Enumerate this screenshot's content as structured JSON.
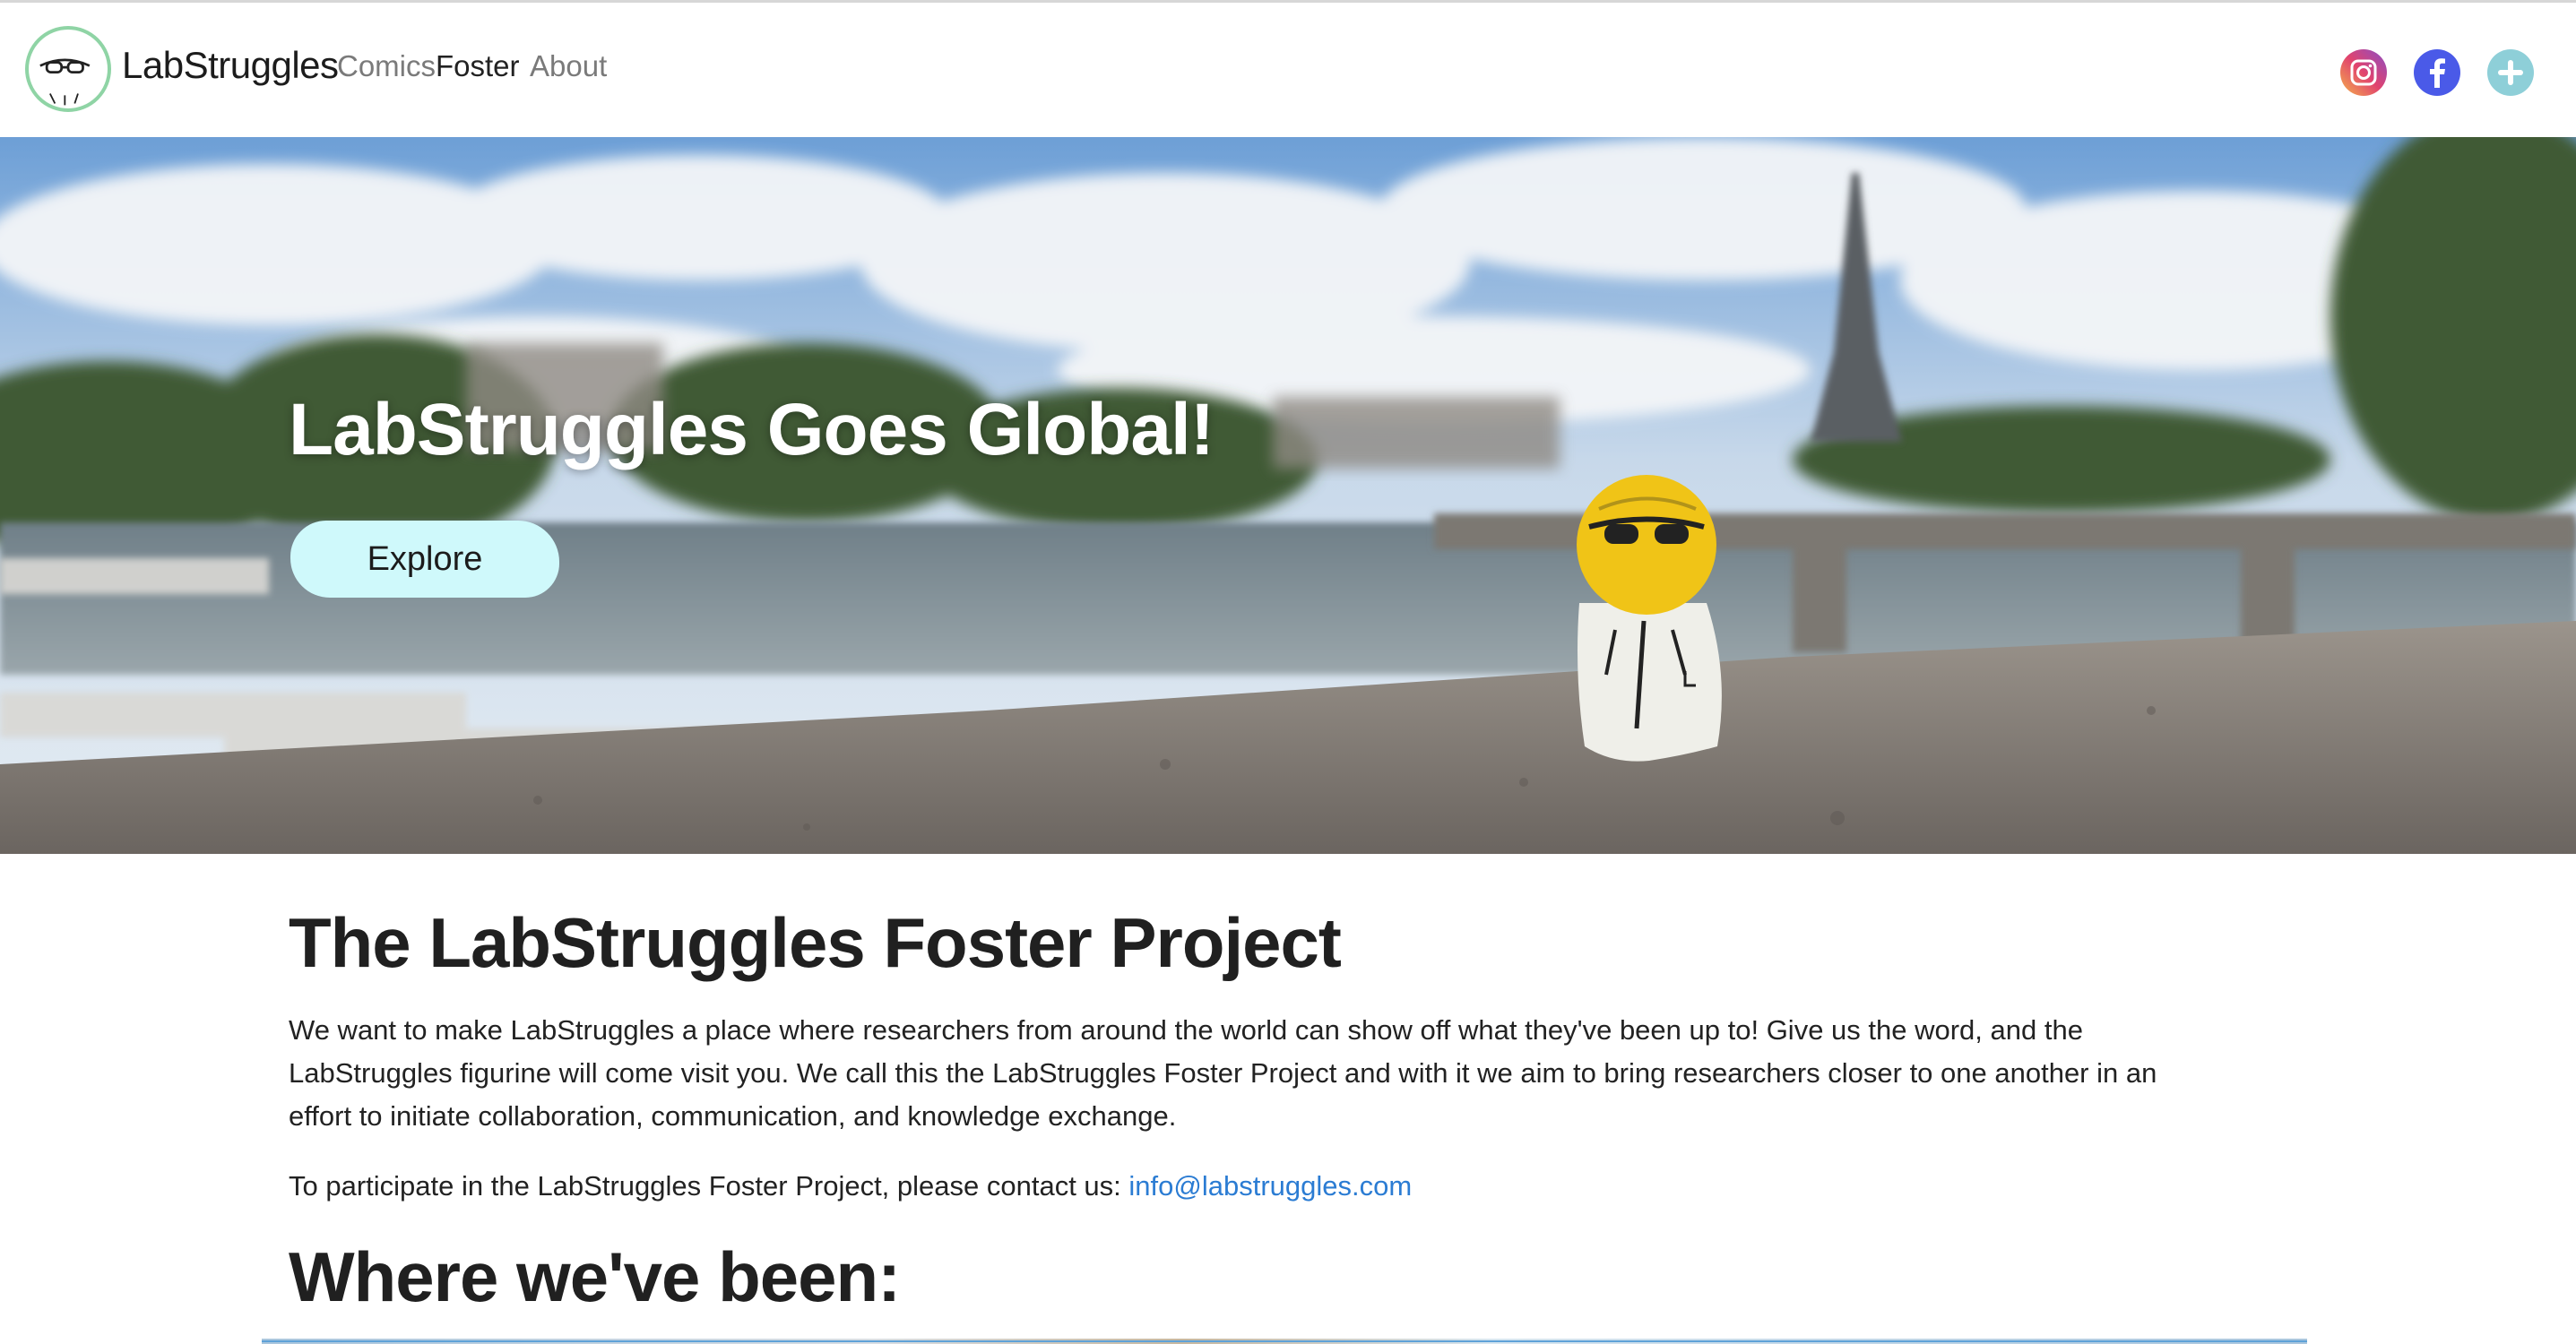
{
  "navbar": {
    "brand": "LabStruggles",
    "links": [
      "Comics",
      "Foster",
      "About"
    ],
    "active_link": "Foster",
    "social": [
      "instagram-icon",
      "facebook-icon",
      "plus-icon"
    ]
  },
  "hero": {
    "title": "LabStruggles Goes Global!",
    "button_label": "Explore"
  },
  "content": {
    "title": "The LabStruggles Foster Project",
    "paragraph": "We want to make LabStruggles a place where researchers from around the world can show off what they've been up to! Give us the word, and the LabStruggles figurine will come visit you. We call this the LabStruggles Foster Project and with it we aim to bring researchers closer to one another in an effort to initiate collaboration, communication, and knowledge exchange.",
    "contact_text": "To participate in the LabStruggles Foster Project, please contact us: ",
    "contact_email": "info@labstruggles.com",
    "subtitle": "Where we've been:"
  },
  "colors": {
    "button_bg": "#cff9fb",
    "link": "#2b7cd3",
    "logo_ring": "#8fd4a5",
    "facebook": "#4a5ae8",
    "plus": "#8ecfd8"
  }
}
